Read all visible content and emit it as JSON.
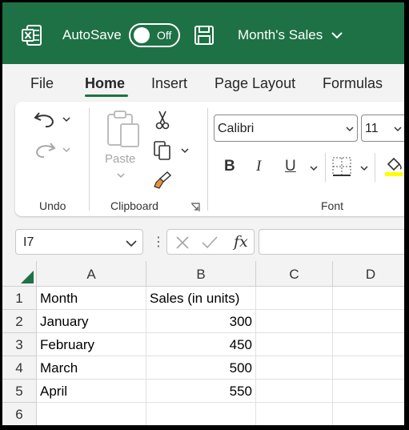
{
  "titlebar": {
    "autosave_label": "AutoSave",
    "autosave_state": "Off",
    "document_title": "Month's Sales",
    "icons": [
      "excel-logo-icon",
      "save-icon",
      "chevron-down-icon"
    ],
    "background_color": "#1e7145"
  },
  "menu": {
    "tabs": [
      "File",
      "Home",
      "Insert",
      "Page Layout",
      "Formulas"
    ],
    "active_tab": "Home"
  },
  "ribbon": {
    "groups": {
      "undo": "Undo",
      "clipboard": "Clipboard",
      "font": "Font"
    },
    "paste_label": "Paste",
    "font_name": "Calibri",
    "font_size": "11",
    "format_buttons": {
      "bold": "B",
      "italic": "I",
      "underline": "U"
    },
    "icons": [
      "undo-icon",
      "redo-icon",
      "paste-icon",
      "cut-icon",
      "copy-icon",
      "format-painter-icon",
      "dialog-launcher-icon",
      "borders-icon",
      "fill-color-icon"
    ]
  },
  "formula_bar": {
    "name_box": "I7",
    "fx_label": "fx",
    "formula": ""
  },
  "sheet": {
    "columns": [
      "A",
      "B",
      "C",
      "D"
    ],
    "rows": [
      "1",
      "2",
      "3",
      "4",
      "5",
      "6"
    ],
    "cells": [
      [
        "Month",
        "Sales (in units)",
        "",
        ""
      ],
      [
        "January",
        "300",
        "",
        ""
      ],
      [
        "February",
        "450",
        "",
        ""
      ],
      [
        "March",
        "500",
        "",
        ""
      ],
      [
        "April",
        "550",
        "",
        ""
      ],
      [
        "",
        "",
        "",
        ""
      ]
    ]
  }
}
